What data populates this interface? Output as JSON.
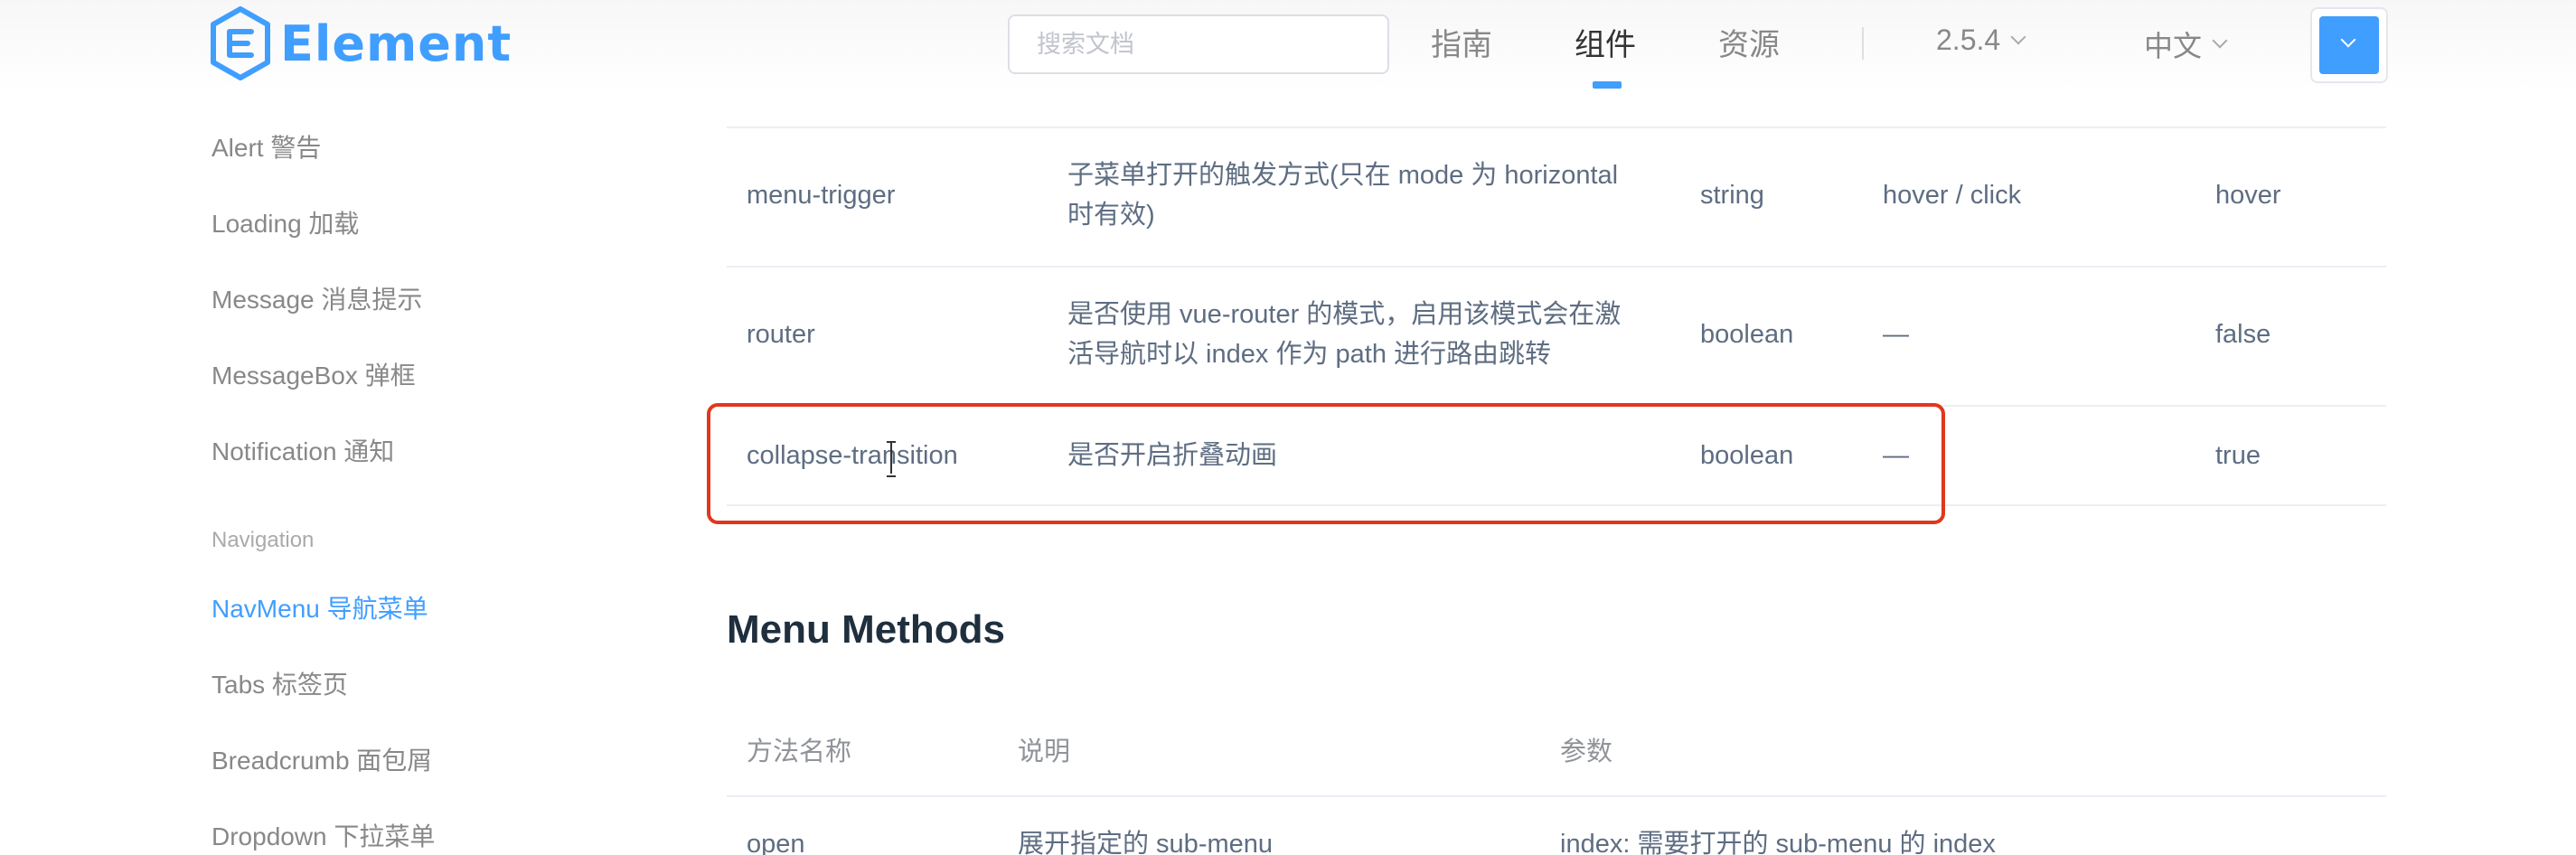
{
  "header": {
    "logo_text": "Element",
    "search_placeholder": "搜索文档",
    "nav": [
      "指南",
      "组件",
      "资源"
    ],
    "active_nav": "组件",
    "version": "2.5.4",
    "language": "中文",
    "accent_color": "#409eff"
  },
  "sidebar": {
    "items_top": [
      "Alert 警告",
      "Loading 加载",
      "Message 消息提示",
      "MessageBox 弹框",
      "Notification 通知"
    ],
    "group_label": "Navigation",
    "items_nav": [
      "NavMenu 导航菜单",
      "Tabs 标签页",
      "Breadcrumb 面包屑",
      "Dropdown 下拉菜单"
    ],
    "active_item": "NavMenu 导航菜单"
  },
  "attributes_table": {
    "rows": [
      {
        "param": "menu-trigger",
        "desc": [
          "子菜单打开的触发方式(只在 mode 为 horizontal",
          "时有效)"
        ],
        "type": "string",
        "options": "hover / click",
        "default": "hover"
      },
      {
        "param": "router",
        "desc": [
          "是否使用 vue-router 的模式，启用该模式会在激",
          "活导航时以 index 作为 path 进行路由跳转"
        ],
        "type": "boolean",
        "options": "—",
        "default": "false"
      },
      {
        "param": "collapse-transition",
        "desc": [
          "是否开启折叠动画"
        ],
        "type": "boolean",
        "options": "—",
        "default": "true"
      }
    ],
    "highlight_color": "#e0381d"
  },
  "methods": {
    "title": "Menu Methods",
    "headers": [
      "方法名称",
      "说明",
      "参数"
    ],
    "rows": [
      {
        "name": "open",
        "desc": "展开指定的 sub-menu",
        "params": "index: 需要打开的 sub-menu 的 index"
      }
    ]
  }
}
